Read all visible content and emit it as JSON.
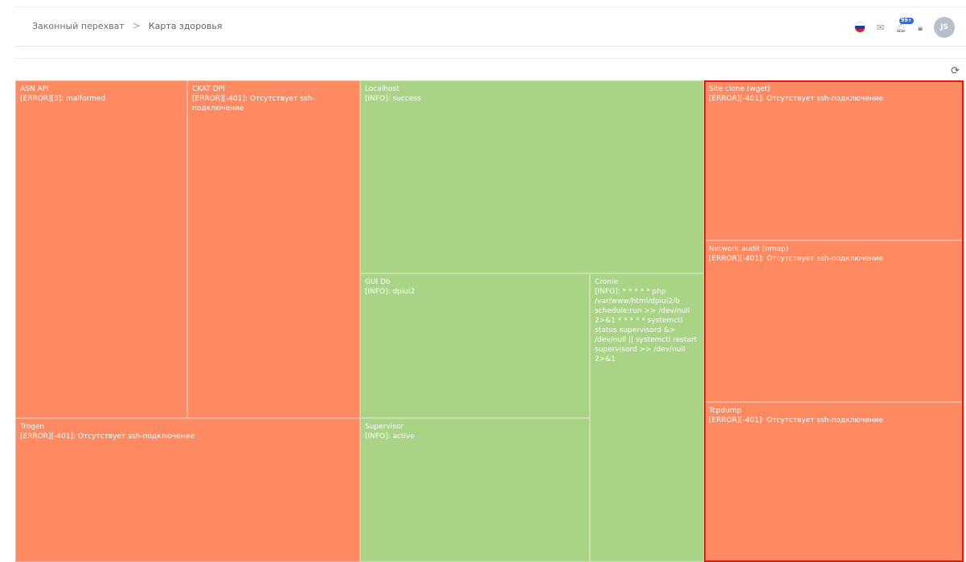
{
  "breadcrumb": {
    "items": [
      "Законный перехват",
      "Карта здоровья"
    ],
    "separator": ">"
  },
  "header": {
    "flag_icon": "russia-flag-icon",
    "mail_icon": "mail-icon",
    "notifications_icon": "bell-icon",
    "notifications_badge": "99+",
    "lock_icon": "lock-icon",
    "avatar_initials": "JS"
  },
  "colors": {
    "error": "#ff8a62",
    "ok": "#a9d385",
    "highlight": "#e01a1a"
  },
  "refresh_icon": "refresh-icon",
  "tiles": [
    {
      "id": "asn-api",
      "name": "ASN API",
      "message": "[ERROR][3]: malformed",
      "status": "error"
    },
    {
      "id": "ckat-dpi",
      "name": "CKAT DPI",
      "message": "[ERROR][-401]: Отсутствует ssh-подключение",
      "status": "error"
    },
    {
      "id": "localhost",
      "name": "Localhost",
      "message": "[INFO]: success",
      "status": "ok"
    },
    {
      "id": "site-clone",
      "name": "Site clone (wget)",
      "message": "[ERROR][-401]: Отсутствует ssh-подключение",
      "status": "error"
    },
    {
      "id": "gui-db",
      "name": "GUI Db",
      "message": "[INFO]: dpiui2",
      "status": "ok"
    },
    {
      "id": "cronie",
      "name": "Cronie",
      "message": "[INFO]: * * * * * php /var/www/html/dpiui2/b schedule:run >> /dev/null 2>&1 * * * * * systemctl status supervisord &> /dev/null || systemctl restart supervisord >> /dev/null 2>&1",
      "status": "ok"
    },
    {
      "id": "network-audit",
      "name": "Network audit (nmap)",
      "message": "[ERROR][-401]: Отсутствует ssh-подключение",
      "status": "error"
    },
    {
      "id": "trogen",
      "name": "Trogen",
      "message": "[ERROR][-401]: Отсутствует ssh-подключение",
      "status": "error"
    },
    {
      "id": "supervisor",
      "name": "Supervisor",
      "message": "[INFO]: active",
      "status": "ok"
    },
    {
      "id": "tcpdump",
      "name": "Tcpdump",
      "message": "[ERROR][-401]: Отсутствует ssh-подключение",
      "status": "error"
    }
  ]
}
